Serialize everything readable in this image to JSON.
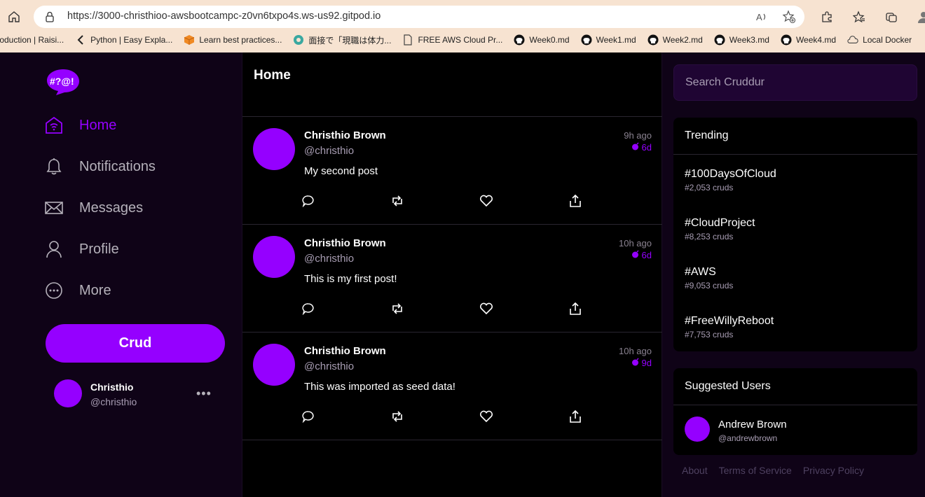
{
  "browser": {
    "url_host": "https://3000-christhioo-awsbootcampc-z0vn6txpo4s.ws-us92.gitpod.io",
    "bookmarks": [
      {
        "label": "troduction | Raisi...",
        "icon": "page-icon"
      },
      {
        "label": "Python | Easy Expla...",
        "icon": "chevron-icon"
      },
      {
        "label": "Learn best practices...",
        "icon": "box-icon"
      },
      {
        "label": "面接で「現職は体力...",
        "icon": "globe-icon"
      },
      {
        "label": "FREE AWS Cloud Pr...",
        "icon": "page-icon"
      },
      {
        "label": "Week0.md",
        "icon": "github-icon"
      },
      {
        "label": "Week1.md",
        "icon": "github-icon"
      },
      {
        "label": "Week2.md",
        "icon": "github-icon"
      },
      {
        "label": "Week3.md",
        "icon": "github-icon"
      },
      {
        "label": "Week4.md",
        "icon": "github-icon"
      },
      {
        "label": "Local Docker",
        "icon": "cloud-icon"
      }
    ]
  },
  "nav": {
    "items": [
      {
        "label": "Home",
        "icon": "home-icon",
        "active": true
      },
      {
        "label": "Notifications",
        "icon": "bell-icon",
        "active": false
      },
      {
        "label": "Messages",
        "icon": "mail-icon",
        "active": false
      },
      {
        "label": "Profile",
        "icon": "person-icon",
        "active": false
      },
      {
        "label": "More",
        "icon": "more-icon",
        "active": false
      }
    ],
    "crud_label": "Crud",
    "user": {
      "name": "Christhio",
      "handle": "@christhio"
    }
  },
  "feed": {
    "title": "Home",
    "activities": [
      {
        "display_name": "Christhio Brown",
        "handle": "@christhio",
        "message": "My second post",
        "ago": "9h ago",
        "expires": "6d"
      },
      {
        "display_name": "Christhio Brown",
        "handle": "@christhio",
        "message": "This is my first post!",
        "ago": "10h ago",
        "expires": "6d"
      },
      {
        "display_name": "Christhio Brown",
        "handle": "@christhio",
        "message": "This was imported as seed data!",
        "ago": "10h ago",
        "expires": "9d"
      }
    ]
  },
  "sidebar": {
    "search_placeholder": "Search Cruddur",
    "trending_title": "Trending",
    "trending": [
      {
        "name": "#100DaysOfCloud",
        "count": "#2,053 cruds"
      },
      {
        "name": "#CloudProject",
        "count": "#8,253 cruds"
      },
      {
        "name": "#AWS",
        "count": "#9,053 cruds"
      },
      {
        "name": "#FreeWillyReboot",
        "count": "#7,753 cruds"
      }
    ],
    "suggested_title": "Suggested Users",
    "suggested": [
      {
        "name": "Andrew Brown",
        "handle": "@andrewbrown"
      }
    ],
    "footer": [
      "About",
      "Terms of Service",
      "Privacy Policy"
    ]
  },
  "colors": {
    "accent": "#9500ff",
    "panel": "#0f0317",
    "search_bg": "#1f0533"
  }
}
